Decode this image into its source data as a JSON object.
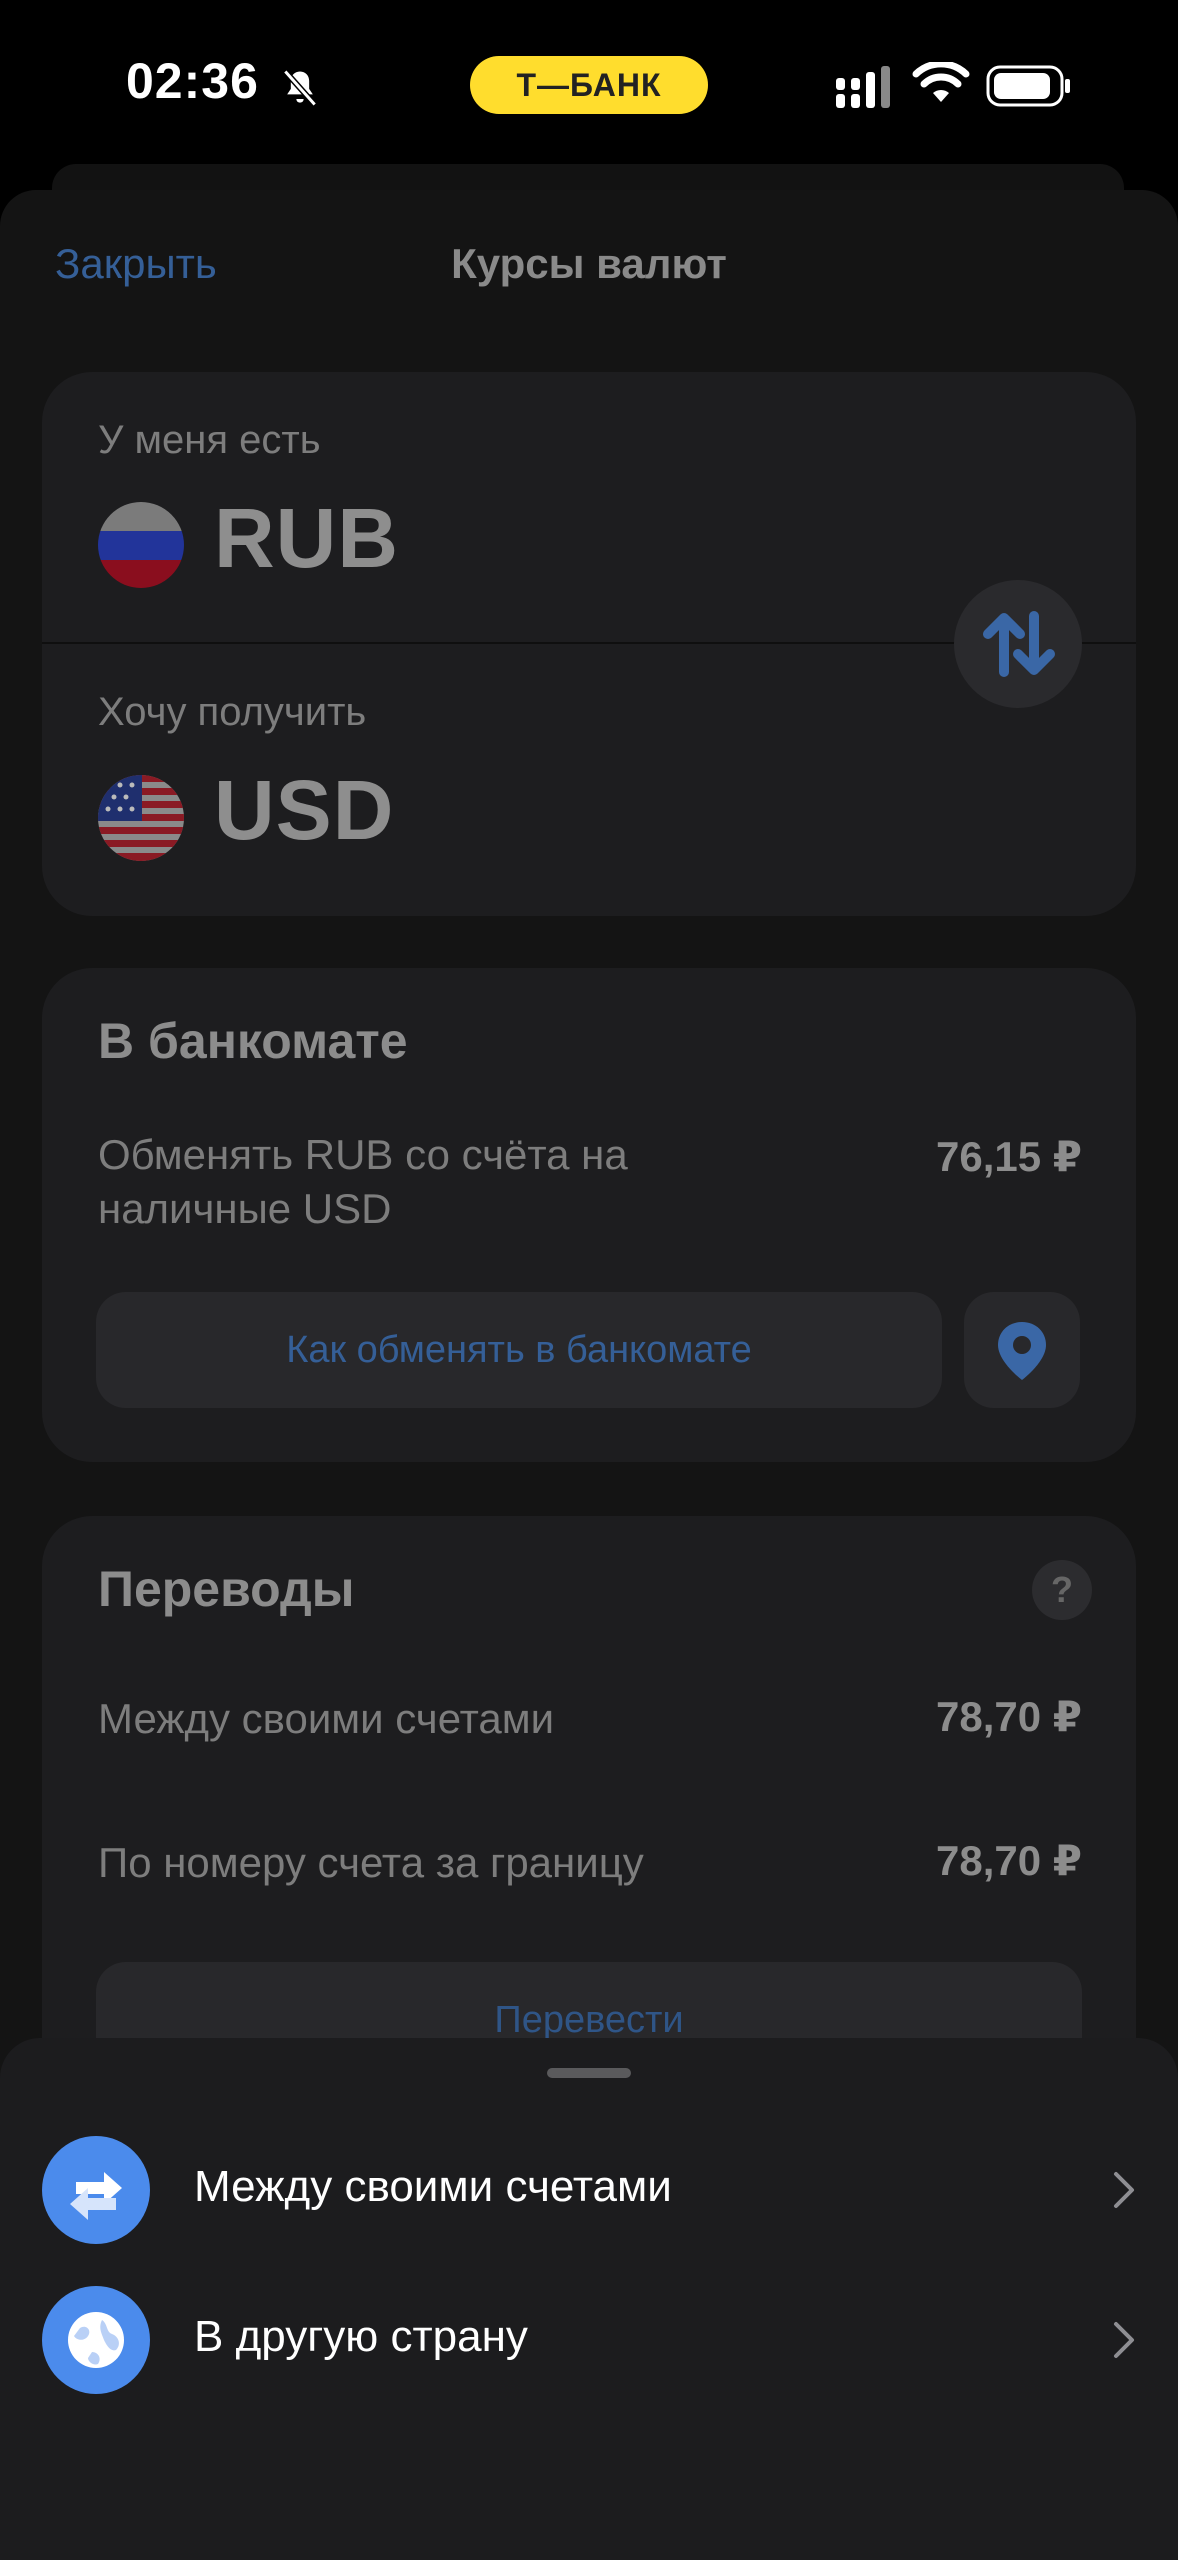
{
  "status_bar": {
    "time": "02:36",
    "bank_badge": "Т—БАНК",
    "icons": [
      "bell-slash-icon",
      "signal-icon",
      "wifi-icon",
      "battery-icon"
    ]
  },
  "header": {
    "close_label": "Закрыть",
    "title": "Курсы валют"
  },
  "exchange": {
    "have_label": "У меня есть",
    "have_currency": "RUB",
    "want_label": "Хочу получить",
    "want_currency": "USD",
    "swap_icon": "swap-vertical-icon"
  },
  "atm": {
    "title": "В банкомате",
    "desc": "Обменять RUB со счёта на наличные USD",
    "rate": "76,15 ₽",
    "button_label": "Как обменять в банкомате",
    "pin_icon": "map-pin-icon"
  },
  "transfers": {
    "title": "Переводы",
    "help": "?",
    "rows": [
      {
        "label": "Между своими счетами",
        "value": "78,70 ₽"
      },
      {
        "label": "По номеру счета за границу",
        "value": "78,70 ₽"
      }
    ],
    "button_label": "Перевести"
  },
  "bottom_sheet": {
    "items": [
      {
        "label": "Между своими счетами",
        "icon": "transfer-arrows-icon"
      },
      {
        "label": "В другую страну",
        "icon": "globe-icon"
      }
    ]
  },
  "colors": {
    "accent_link": "#355f97",
    "brand_yellow": "#ffdd2d",
    "sheet_icon_blue": "#4b8bec"
  }
}
